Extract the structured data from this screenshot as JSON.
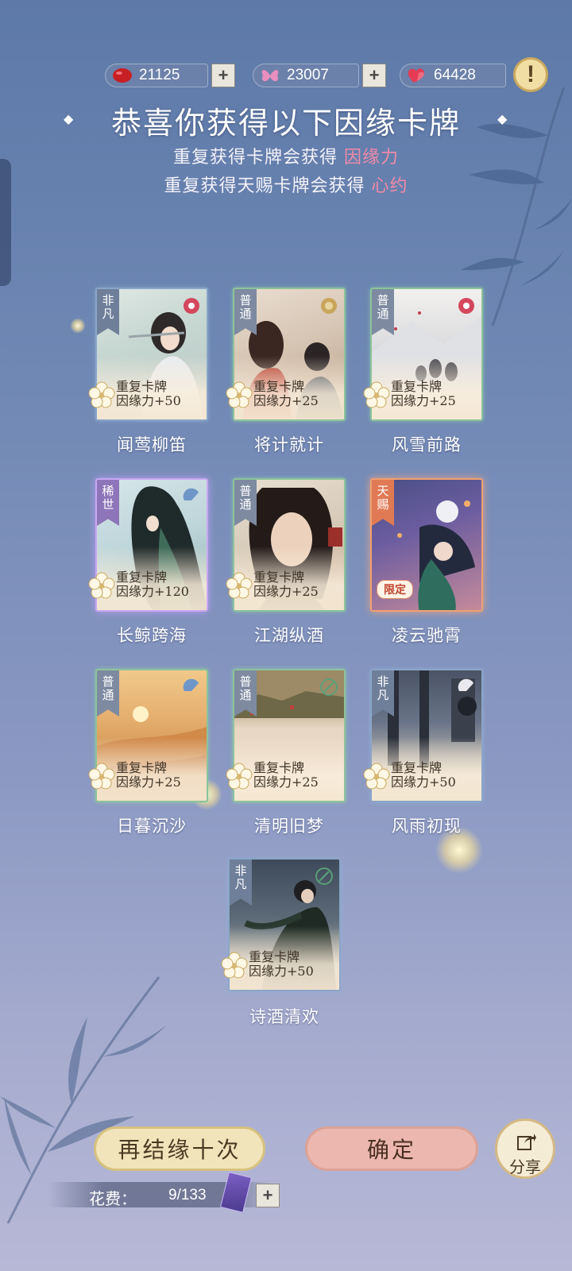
{
  "currencies": [
    {
      "icon": "red-bean-icon",
      "value": "21125"
    },
    {
      "icon": "butterfly-icon",
      "value": "23007"
    },
    {
      "icon": "heart-icon",
      "value": "64428"
    }
  ],
  "plus_label": "+",
  "warning_label": "!",
  "header": {
    "title": "恭喜你获得以下因缘卡牌",
    "line1_prefix": "重复获得卡牌会获得",
    "line1_highlight": "因缘力",
    "line2_prefix": "重复获得天赐卡牌会获得",
    "line2_highlight": "心约"
  },
  "cards": [
    {
      "name": "闻莺柳笛",
      "rarity": "非凡",
      "dup": "重复卡牌",
      "bonus": "因缘力+50"
    },
    {
      "name": "将计就计",
      "rarity": "普通",
      "dup": "重复卡牌",
      "bonus": "因缘力+25"
    },
    {
      "name": "风雪前路",
      "rarity": "普通",
      "dup": "重复卡牌",
      "bonus": "因缘力+25"
    },
    {
      "name": "长鲸跨海",
      "rarity": "稀世",
      "dup": "重复卡牌",
      "bonus": "因缘力+120"
    },
    {
      "name": "江湖纵酒",
      "rarity": "普通",
      "dup": "重复卡牌",
      "bonus": "因缘力+25"
    },
    {
      "name": "凌云驰霄",
      "rarity": "天赐",
      "limited": "限定"
    },
    {
      "name": "日暮沉沙",
      "rarity": "普通",
      "dup": "重复卡牌",
      "bonus": "因缘力+25"
    },
    {
      "name": "清明旧梦",
      "rarity": "普通",
      "dup": "重复卡牌",
      "bonus": "因缘力+25"
    },
    {
      "name": "风雨初现",
      "rarity": "非凡",
      "dup": "重复卡牌",
      "bonus": "因缘力+50"
    },
    {
      "name": "诗酒清欢",
      "rarity": "非凡",
      "dup": "重复卡牌",
      "bonus": "因缘力+50"
    }
  ],
  "buttons": {
    "again": "再结缘十次",
    "confirm": "确定",
    "share": "分享"
  },
  "cost": {
    "label": "花费：",
    "value": "9/133"
  }
}
